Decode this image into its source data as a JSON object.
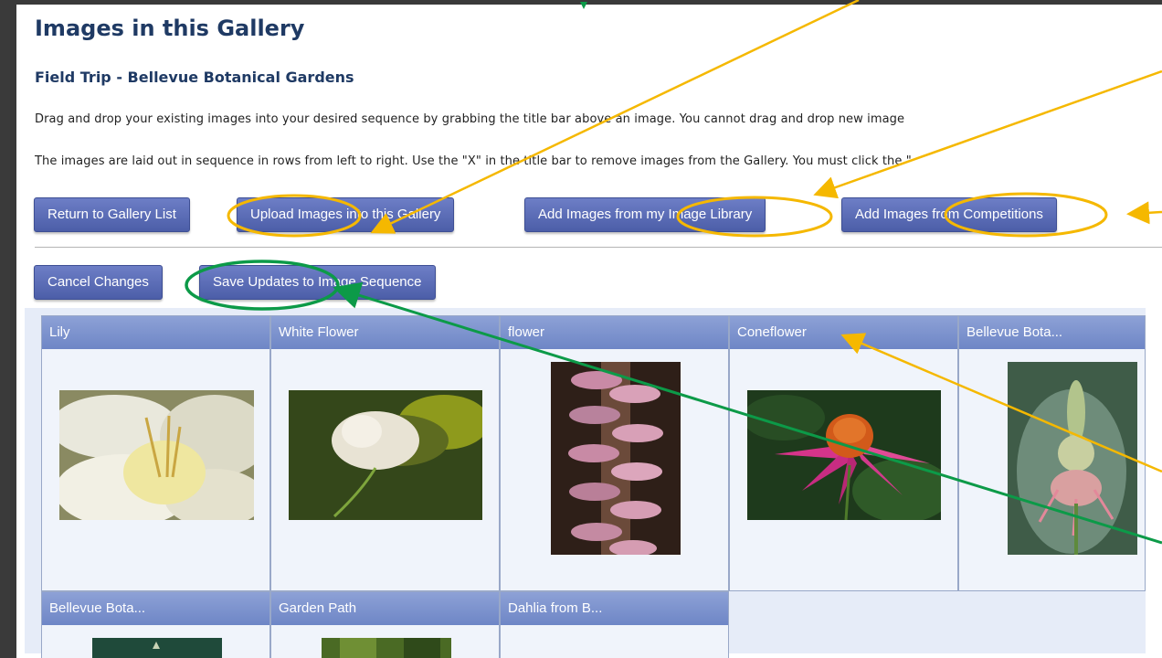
{
  "page": {
    "title": "Images in this Gallery",
    "gallery_name": "Field Trip - Bellevue Botanical Gardens",
    "instruction_1": "Drag and drop your existing images into your desired sequence by grabbing the title bar above an image. You cannot drag and drop new image",
    "instruction_2": "The images are laid out in sequence in rows from left to right. Use the \"X\" in the title bar to remove images from the Gallery. You must click the \""
  },
  "toolbar": {
    "return_label": "Return to Gallery List",
    "upload_label": "Upload Images into this Gallery",
    "add_library_label": "Add Images from my Image Library",
    "add_competitions_label": "Add Images from Competitions"
  },
  "actions": {
    "cancel_label": "Cancel Changes",
    "save_label": "Save Updates to Image Sequence"
  },
  "gallery": {
    "images": [
      {
        "title": "Lily"
      },
      {
        "title": "White Flower"
      },
      {
        "title": "flower"
      },
      {
        "title": "Coneflower"
      },
      {
        "title": "Bellevue Bota..."
      },
      {
        "title": "Bellevue Bota..."
      },
      {
        "title": "Garden Path"
      },
      {
        "title": "Dahlia from B..."
      }
    ]
  },
  "colors": {
    "button": "#5566b3",
    "title_bar": "#7f94cf",
    "annotation_yellow": "#f5b800",
    "annotation_green": "#0c9a48"
  }
}
